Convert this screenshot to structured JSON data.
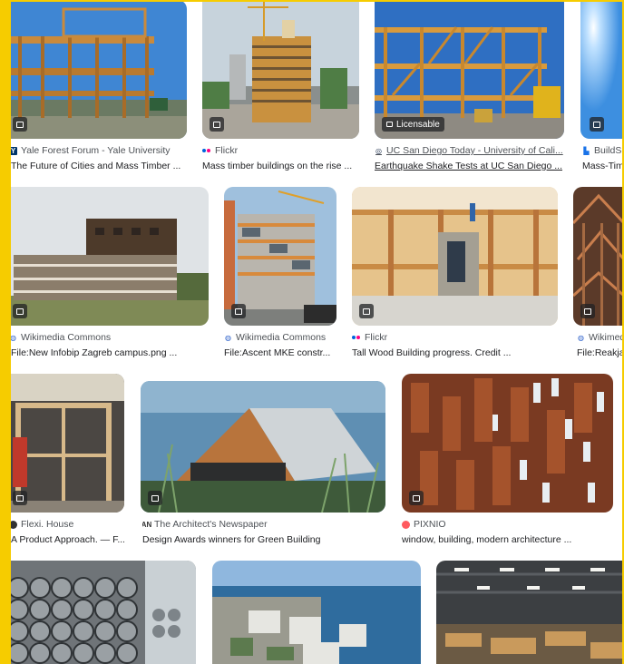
{
  "results": [
    {
      "source": "Yale Forest Forum - Yale University",
      "title": "The Future of Cities and Mass Timber ...",
      "favicon": "yale-icon",
      "licensable": false
    },
    {
      "source": "Flickr",
      "title": "Mass timber buildings on the rise ...",
      "favicon": "flickr-icon",
      "licensable": false
    },
    {
      "source": "UC San Diego Today - University of Cali...",
      "title": "Earthquake Shake Tests at UC San Diego ...",
      "favicon": "ucsd-icon",
      "licensable": true,
      "badge_label": "Licensable"
    },
    {
      "source": "BuildS",
      "title": "Mass-Tim",
      "favicon": "building-icon",
      "licensable": false
    },
    {
      "source": "Wikimedia Commons",
      "title": "File:New Infobip Zagreb campus.png ...",
      "favicon": "wikimedia-icon",
      "licensable": false
    },
    {
      "source": "Wikimedia Commons",
      "title": "File:Ascent MKE constr...",
      "favicon": "wikimedia-icon",
      "licensable": false
    },
    {
      "source": "Flickr",
      "title": "Tall Wood Building progress. Credit ...",
      "favicon": "flickr-icon",
      "licensable": false
    },
    {
      "source": "Wikimed",
      "title": "File:Reakja",
      "favicon": "wikimedia-icon",
      "licensable": false
    },
    {
      "source": "Flexi. House",
      "title": "A Product Approach. — F...",
      "favicon": "flexi-icon",
      "licensable": false
    },
    {
      "source": "The Architect's Newspaper",
      "title": "Design Awards winners for Green Building",
      "favicon": "architects-newspaper-icon",
      "licensable": false
    },
    {
      "source": "PIXNIO",
      "title": "window, building, modern architecture ...",
      "favicon": "pixnio-icon",
      "licensable": false
    },
    {
      "source": "",
      "title": "",
      "favicon": "",
      "licensable": false
    },
    {
      "source": "",
      "title": "",
      "favicon": "",
      "licensable": false
    },
    {
      "source": "",
      "title": "",
      "favicon": "",
      "licensable": false
    }
  ],
  "colors": {
    "frame": "#f6cc00",
    "text": "#202124",
    "muted": "#4d5156"
  }
}
